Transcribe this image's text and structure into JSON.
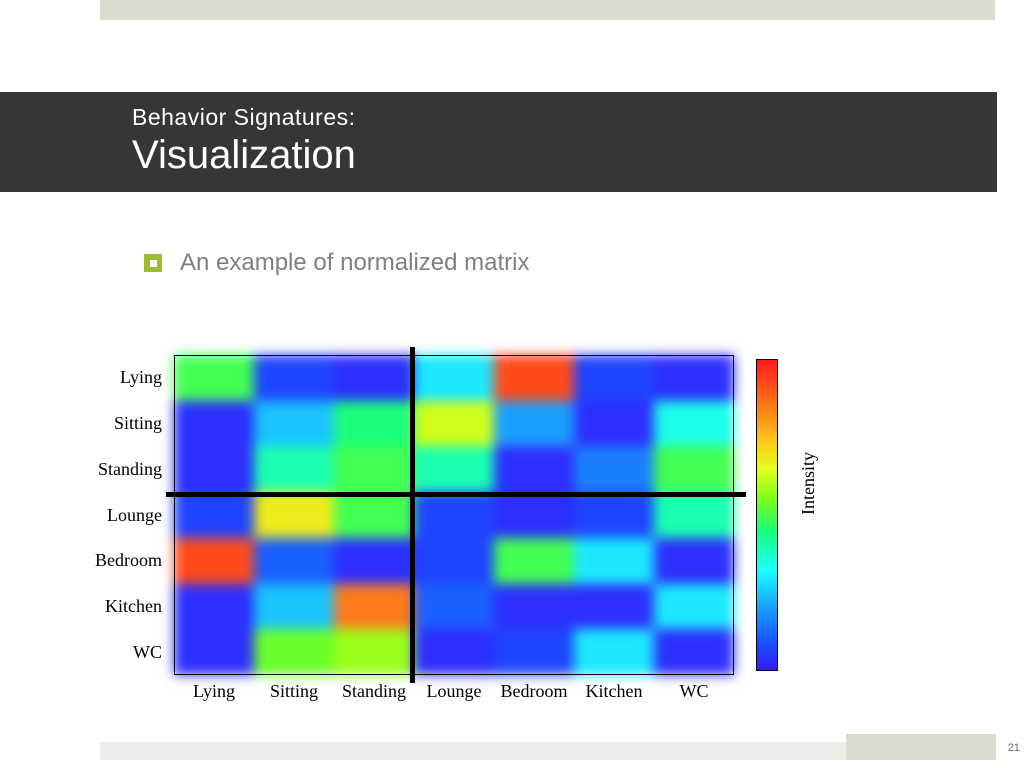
{
  "title": {
    "small": "Behavior Signatures:",
    "large": "Visualization"
  },
  "bullet": {
    "text": "An example of normalized matrix"
  },
  "page_number": "21",
  "chart_data": {
    "type": "heatmap",
    "xlabel": "",
    "ylabel": "",
    "colorbar_label": "Intensity",
    "x_categories": [
      "Lying",
      "Sitting",
      "Standing",
      "Lounge",
      "Bedroom",
      "Kitchen",
      "WC"
    ],
    "y_categories": [
      "Lying",
      "Sitting",
      "Standing",
      "Lounge",
      "Bedroom",
      "Kitchen",
      "WC"
    ],
    "row_divider_after_index": 2,
    "col_divider_after_index": 2,
    "color_scale": [
      "#3a1aff",
      "#1a4cff",
      "#1a9fff",
      "#1affff",
      "#1aff7a",
      "#7aff1a",
      "#e6ff1a",
      "#ffbf1a",
      "#ff7a1a",
      "#ff1a1a"
    ],
    "values": [
      [
        0.55,
        0.1,
        0.05,
        0.35,
        0.95,
        0.1,
        0.05
      ],
      [
        0.05,
        0.3,
        0.5,
        0.7,
        0.25,
        0.05,
        0.4
      ],
      [
        0.05,
        0.45,
        0.55,
        0.45,
        0.05,
        0.2,
        0.55
      ],
      [
        0.1,
        0.75,
        0.55,
        0.1,
        0.05,
        0.1,
        0.45
      ],
      [
        0.95,
        0.15,
        0.05,
        0.1,
        0.55,
        0.35,
        0.05
      ],
      [
        0.05,
        0.3,
        0.9,
        0.15,
        0.05,
        0.05,
        0.35
      ],
      [
        0.05,
        0.6,
        0.65,
        0.05,
        0.1,
        0.35,
        0.05
      ]
    ]
  }
}
